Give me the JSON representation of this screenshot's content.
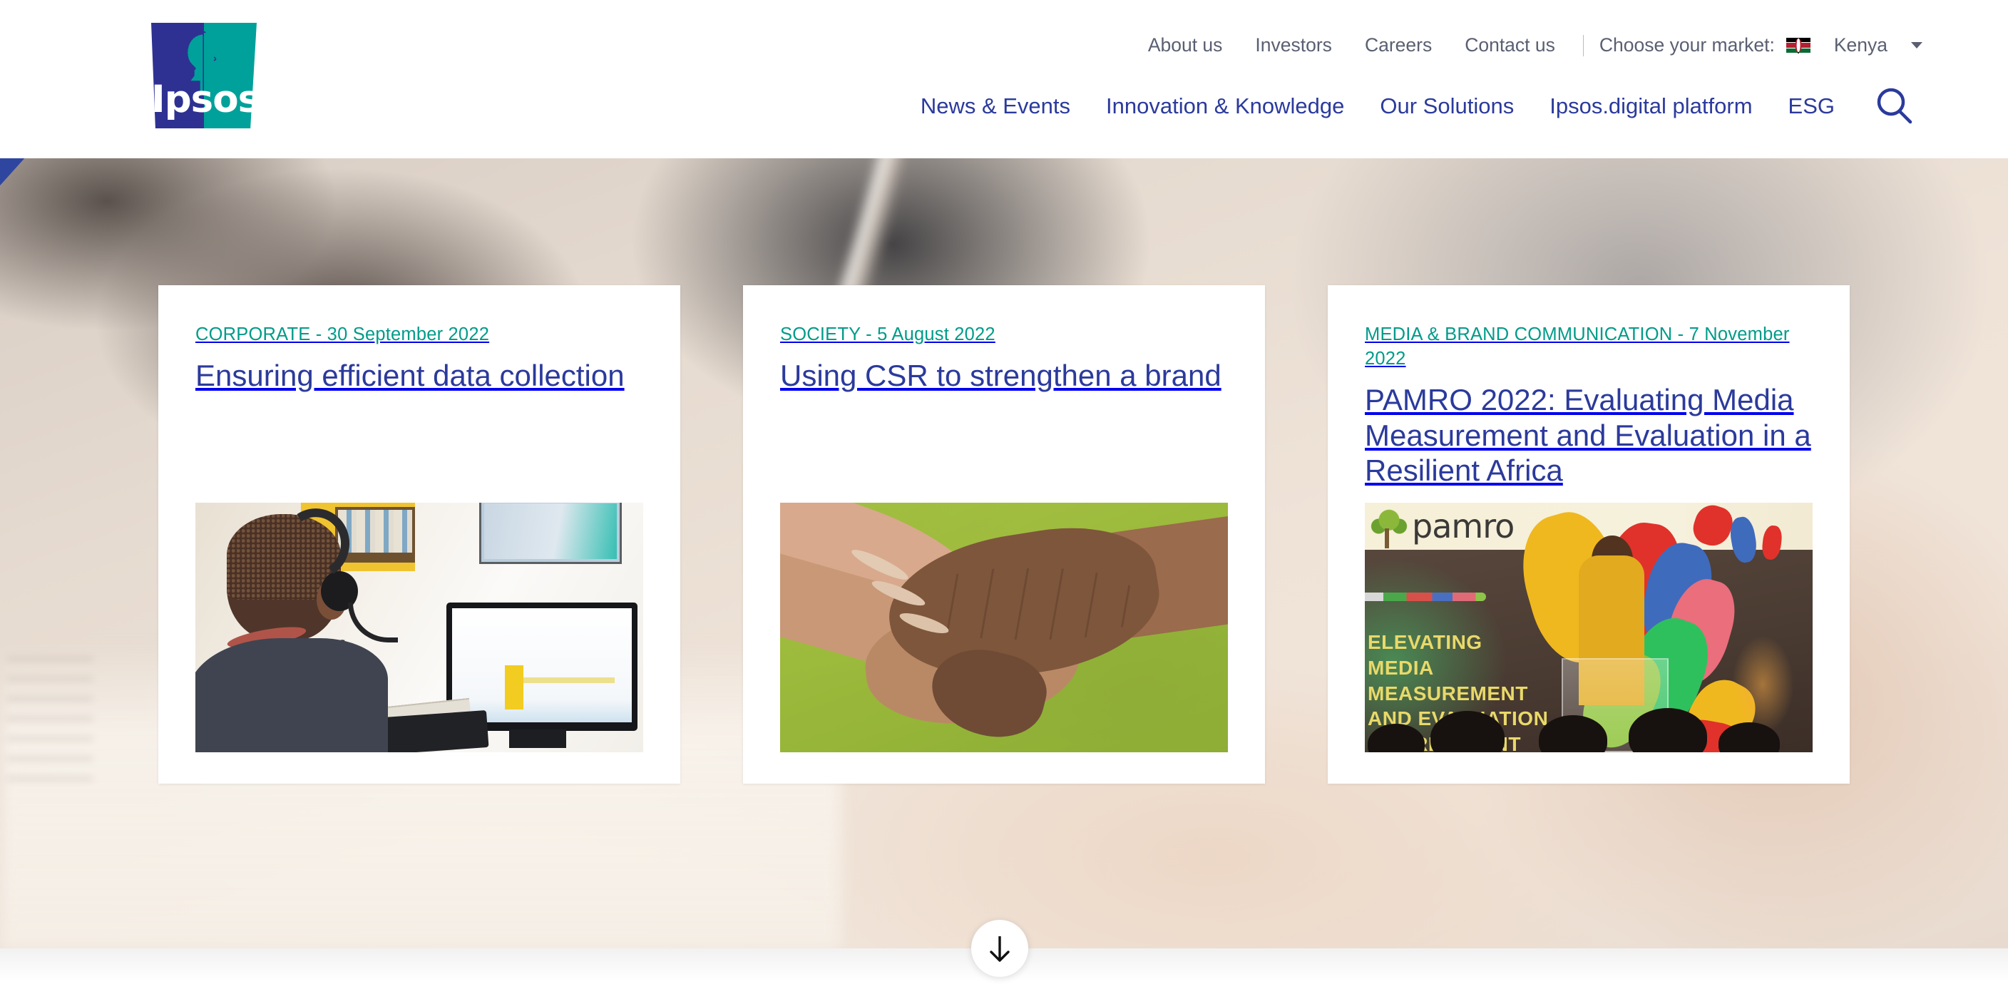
{
  "brand": {
    "name": "Ipsos",
    "logo_blue": "#2E3192",
    "logo_teal": "#00A19A"
  },
  "colors": {
    "nav_blue": "#2B3A9C",
    "meta_teal": "#009B8A",
    "stripe_teal": "#009B91",
    "stripe_blue": "#2E46A0",
    "topnav_gray": "#5A5F72"
  },
  "header": {
    "top_nav": [
      {
        "label": "About us"
      },
      {
        "label": "Investors"
      },
      {
        "label": "Careers"
      },
      {
        "label": "Contact us"
      }
    ],
    "market": {
      "label": "Choose your market:",
      "selected": "Kenya",
      "flag": "kenya-flag-icon",
      "caret": "chevron-down-icon"
    },
    "main_nav": [
      {
        "label": "News & Events"
      },
      {
        "label": "Innovation & Knowledge"
      },
      {
        "label": "Our Solutions"
      },
      {
        "label": "Ipsos.digital platform"
      },
      {
        "label": "ESG"
      }
    ],
    "search": {
      "icon": "search-icon",
      "label": "Search"
    }
  },
  "hero": {
    "cards": [
      {
        "category": "CORPORATE",
        "date": "30 September 2022",
        "meta": "CORPORATE - 30 September 2022",
        "title": "Ensuring efficient data collection",
        "image_alt": "Call centre agent wearing a headset working at a desktop computer"
      },
      {
        "category": "SOCIETY",
        "date": "5 August 2022",
        "meta": "SOCIETY - 5 August 2022",
        "title": "Using CSR to strengthen a brand",
        "image_alt": "Two hands clasped together over a green grass background"
      },
      {
        "category": "MEDIA & BRAND COMMUNICATION",
        "date": "7 November 2022",
        "meta": "MEDIA & BRAND COMMUNICATION - 7 November 2022",
        "title": "PAMRO 2022: Evaluating Media Measurement and Evaluation in a Resilient Africa",
        "image_alt": "Speaker at a PAMRO conference podium in front of a colourful stage backdrop",
        "image_text": {
          "logo": "pamro",
          "lines": [
            "ELEVATING",
            "MEDIA",
            "MEASUREMENT",
            "AND EVALUATION",
            "IN A RESILIENT"
          ]
        }
      }
    ]
  },
  "scroll": {
    "icon": "arrow-down-icon",
    "label": "Scroll down"
  }
}
